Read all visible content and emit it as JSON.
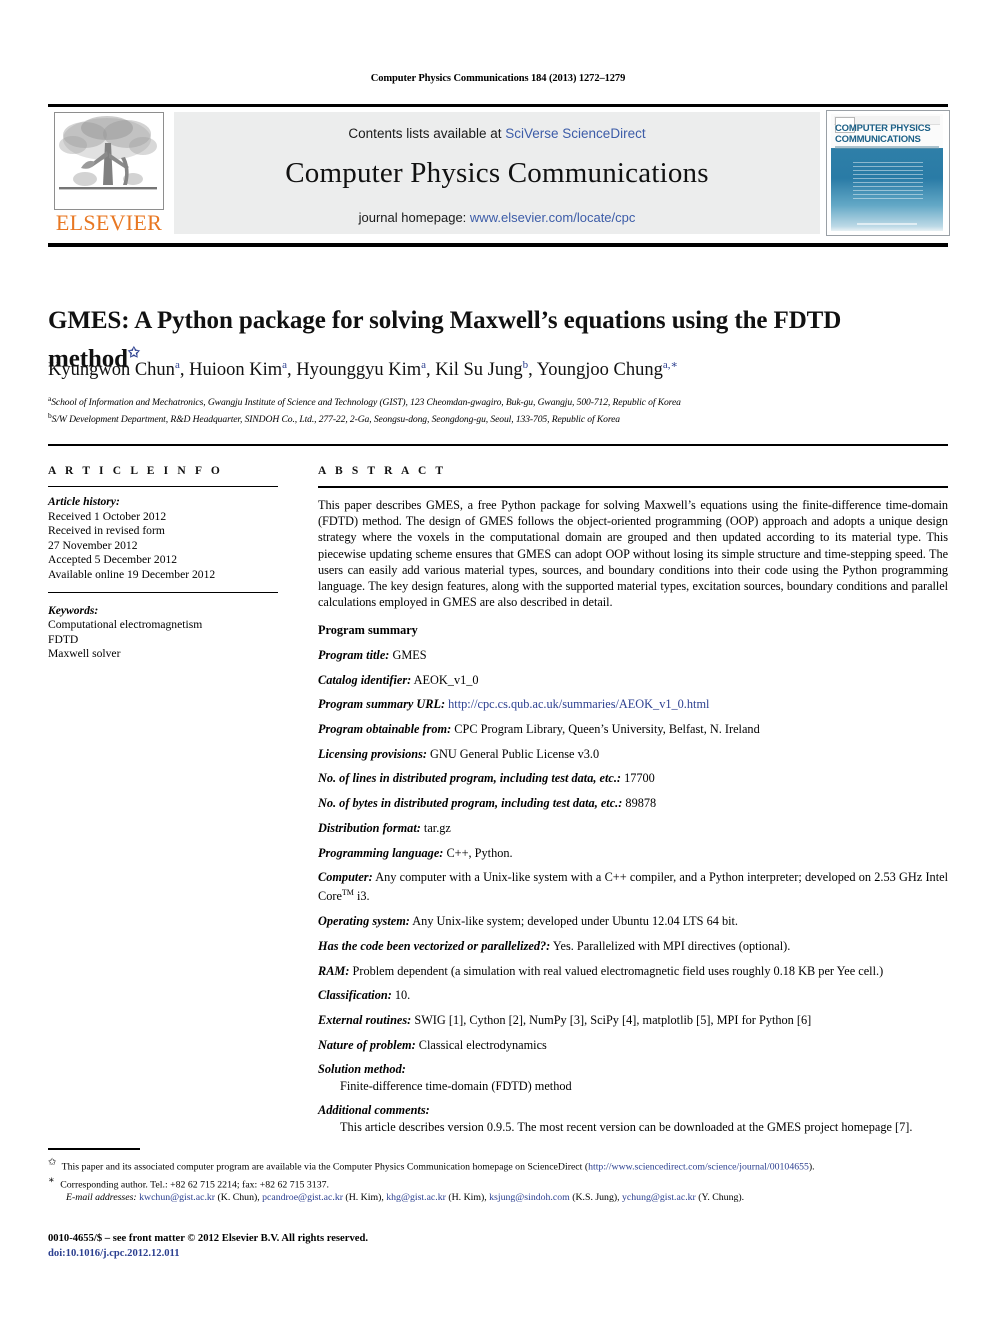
{
  "running_head": "Computer Physics Communications 184 (2013) 1272–1279",
  "masthead": {
    "publisher_name": "ELSEVIER",
    "contents_prefix": "Contents lists available at ",
    "contents_link": "SciVerse ScienceDirect",
    "journal_title": "Computer Physics Communications",
    "homepage_prefix": "journal homepage: ",
    "homepage_link": "www.elsevier.com/locate/cpc",
    "cover_title_line1": "COMPUTER PHYSICS",
    "cover_title_line2": "COMMUNICATIONS",
    "link_color": "#3c5ca8"
  },
  "article": {
    "title": "GMES: A Python package for solving Maxwell’s equations using the FDTD method",
    "title_marker": "✩",
    "authors": "Kyungwon Chun , Huioon Kim , Hyounggyu Kim , Kil Su Jung , Youngjoo Chung",
    "authors_html": [
      {
        "name": "Kyungwon Chun",
        "sup": "a",
        "sep": ", "
      },
      {
        "name": "Huioon Kim",
        "sup": "a",
        "sep": ", "
      },
      {
        "name": "Hyounggyu Kim",
        "sup": "a",
        "sep": ", "
      },
      {
        "name": "Kil Su Jung",
        "sup": "b",
        "sep": ", "
      },
      {
        "name": "Youngjoo Chung",
        "sup": "a,∗",
        "sep": ""
      }
    ],
    "affiliation_a_mark": "a",
    "affiliation_a": "School of Information and Mechatronics, Gwangju Institute of Science and Technology (GIST), 123 Cheomdan-gwagiro, Buk-gu, Gwangju, 500-712, Republic of Korea",
    "affiliation_b_mark": "b",
    "affiliation_b": "S/W Development Department, R&D Headquarter, SINDOH Co., Ltd., 277-22, 2-Ga, Seongsu-dong, Seongdong-gu, Seoul, 133-705, Republic of Korea"
  },
  "article_info": {
    "heading": "A R T I C L E   I N F O",
    "history_label": "Article history:",
    "history_lines": [
      "Received 1 October 2012",
      "Received in revised form",
      "27 November 2012",
      "Accepted 5 December 2012",
      "Available online 19 December 2012"
    ],
    "keywords_label": "Keywords:",
    "keywords": [
      "Computational electromagnetism",
      "FDTD",
      "Maxwell solver"
    ]
  },
  "abstract": {
    "heading": "A B S T R A C T",
    "text": "This paper describes GMES, a free Python package for solving Maxwell’s equations using the finite-difference time-domain (FDTD) method. The design of GMES follows the object-oriented programming (OOP) approach and adopts a unique design strategy where the voxels in the computational domain are grouped and then updated according to its material type. This piecewise updating scheme ensures that GMES can adopt OOP without losing its simple structure and time-stepping speed. The users can easily add various material types, sources, and boundary conditions into their code using the Python programming language. The key design features, along with the supported material types, excitation sources, boundary conditions and parallel calculations employed in GMES are also described in detail."
  },
  "program_summary": {
    "heading": "Program summary",
    "items": [
      {
        "label": "Program title:",
        "value": " GMES"
      },
      {
        "label": "Catalog identifier:",
        "value": " AEOK_v1_0"
      },
      {
        "label": "Program summary URL:",
        "value": " ",
        "link": "http://cpc.cs.qub.ac.uk/summaries/AEOK_v1_0.html"
      },
      {
        "label": "Program obtainable from:",
        "value": " CPC Program Library, Queen’s University, Belfast, N. Ireland"
      },
      {
        "label": "Licensing provisions:",
        "value": " GNU General Public License v3.0"
      },
      {
        "label": "No. of lines in distributed program, including test data, etc.:",
        "value": " 17700"
      },
      {
        "label": "No. of bytes in distributed program, including test data, etc.:",
        "value": " 89878"
      },
      {
        "label": "Distribution format:",
        "value": " tar.gz"
      },
      {
        "label": "Programming language:",
        "value": " C++, Python."
      },
      {
        "label": "Computer:",
        "value": " Any computer with a Unix-like system with a C++ compiler, and a Python interpreter; developed on 2.53 GHz Intel Core",
        "tm": "TM",
        "value_tail": " i3."
      },
      {
        "label": "Operating system:",
        "value": " Any Unix-like system; developed under Ubuntu 12.04 LTS 64 bit."
      },
      {
        "label": "Has the code been vectorized or parallelized?:",
        "value": " Yes. Parallelized with MPI directives (optional)."
      },
      {
        "label": "RAM:",
        "value": " Problem dependent (a simulation with real valued electromagnetic field uses roughly 0.18 KB per Yee cell.)"
      },
      {
        "label": "Classification:",
        "value": " 10."
      },
      {
        "label": "External routines:",
        "value": " SWIG [1], Cython [2], NumPy [3], SciPy [4], matplotlib [5], MPI for Python [6]"
      },
      {
        "label": "Nature of problem:",
        "value": " Classical electrodynamics"
      },
      {
        "label": "Solution method:",
        "value": "",
        "indent": "Finite-difference time-domain (FDTD) method"
      },
      {
        "label": "Additional comments:",
        "value": "",
        "indent": "This article describes version 0.9.5. The most recent version can be downloaded at the GMES project homepage [7]."
      }
    ]
  },
  "footnotes": {
    "star_mark": "✩",
    "star_text_pre": " This paper and its associated computer program are available via the Computer Physics Communication homepage on ScienceDirect   (",
    "star_link": "http://www.sciencedirect.com/science/journal/00104655",
    "star_text_post": ").",
    "corr_mark": "∗",
    "corr_text": " Corresponding author. Tel.: +82 62 715 2214; fax: +82 62 715 3137.",
    "email_label": "E-mail addresses:",
    "emails": [
      {
        "addr": "kwchun@gist.ac.kr",
        "who": " (K. Chun), "
      },
      {
        "addr": "pcandroe@gist.ac.kr",
        "who": " (H. Kim), "
      },
      {
        "addr": "khg@gist.ac.kr",
        "who": " (H. Kim), "
      },
      {
        "addr": "ksjung@sindoh.com",
        "who": " (K.S. Jung), "
      },
      {
        "addr": "ychung@gist.ac.kr",
        "who": " (Y. Chung)."
      }
    ]
  },
  "imprint": {
    "issn_line": "0010-4655/$ – see front matter © 2012 Elsevier B.V. All rights reserved.",
    "doi_line": "doi:10.1016/j.cpc.2012.12.011"
  }
}
